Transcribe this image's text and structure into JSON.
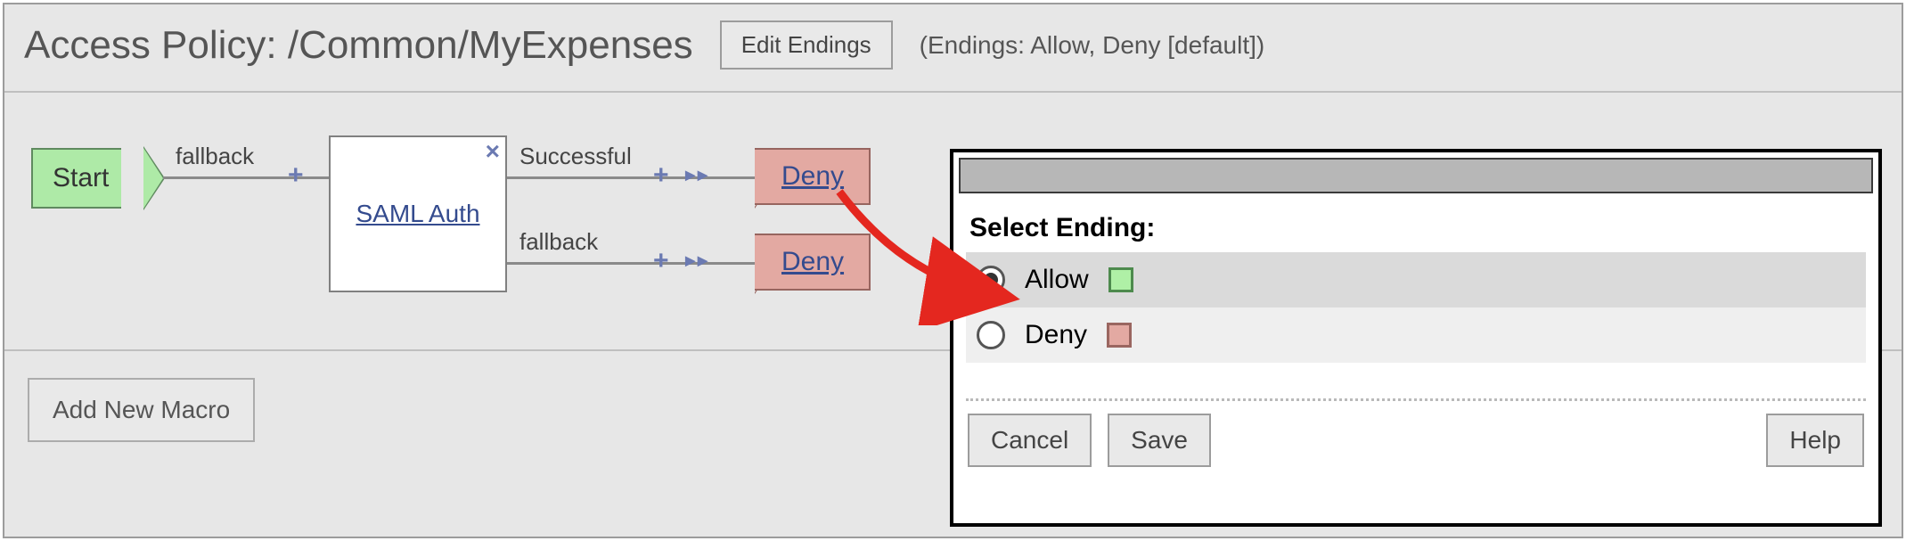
{
  "header": {
    "title": "Access Policy: /Common/MyExpenses",
    "edit_endings_label": "Edit Endings",
    "endings_note": "(Endings: Allow, Deny [default])"
  },
  "flow": {
    "start_label": "Start",
    "fallback_label": "fallback",
    "saml_label": "SAML Auth",
    "successful_label": "Successful",
    "fallback2_label": "fallback",
    "deny1_label": "Deny",
    "deny2_label": "Deny"
  },
  "footer": {
    "add_macro_label": "Add New Macro"
  },
  "dialog": {
    "heading": "Select Ending:",
    "options": {
      "allow": "Allow",
      "deny": "Deny"
    },
    "buttons": {
      "cancel": "Cancel",
      "save": "Save",
      "help": "Help"
    }
  }
}
